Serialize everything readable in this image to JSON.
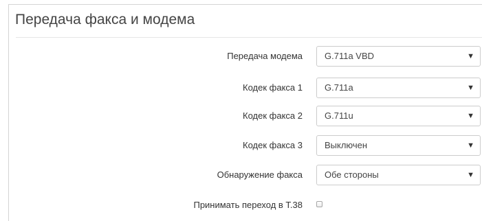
{
  "panel": {
    "title": "Передача факса и модема"
  },
  "fields": {
    "modem_transfer": {
      "label": "Передача модема",
      "value": "G.711a VBD"
    },
    "fax_codec_1": {
      "label": "Кодек факса 1",
      "value": "G.711a"
    },
    "fax_codec_2": {
      "label": "Кодек факса 2",
      "value": "G.711u"
    },
    "fax_codec_3": {
      "label": "Кодек факса 3",
      "value": "Выключен"
    },
    "fax_detection": {
      "label": "Обнаружение факса",
      "value": "Обе стороны"
    },
    "accept_t38": {
      "label": "Принимать переход в T.38",
      "checked": false
    }
  },
  "icons": {
    "dropdown": "chevron-down-icon"
  }
}
